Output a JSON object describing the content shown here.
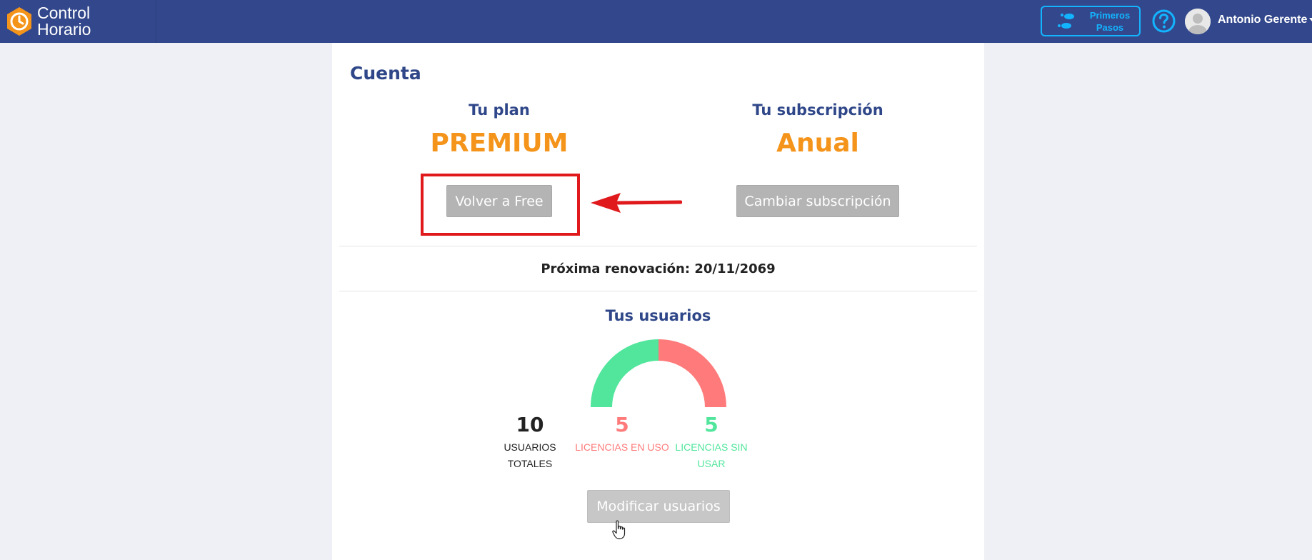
{
  "header": {
    "brand_line1": "Control",
    "brand_line2": "Horario",
    "first_steps_label": "Primeros\nPasos",
    "user_name": "Antonio Gerente",
    "bar_color": "#33488c",
    "accent_color": "#13b4ff"
  },
  "account": {
    "title": "Cuenta",
    "plan_title": "Tu plan",
    "plan_value": "PREMIUM",
    "plan_button": "Volver a Free",
    "subscription_title": "Tu subscripción",
    "subscription_value": "Anual",
    "subscription_button": "Cambiar subscripción",
    "renewal_text": "Próxima renovación: 20/11/2069",
    "value_color": "#f4941b",
    "title_color": "#2f4789"
  },
  "users": {
    "title": "Tus usuarios",
    "total": "10",
    "total_label": "USUARIOS TOTALES",
    "in_use": "5",
    "in_use_label": "LICENCIAS EN USO",
    "unused": "5",
    "unused_label": "LICENCIAS SIN USAR",
    "modify_button": "Modificar usuarios",
    "in_use_color": "#ff7b7b",
    "unused_color": "#51e69c"
  },
  "gauge": {
    "unused_count": 5,
    "in_use_count": 5,
    "total_count": 10
  },
  "annotation": {
    "highlight_color": "#e0191c"
  }
}
